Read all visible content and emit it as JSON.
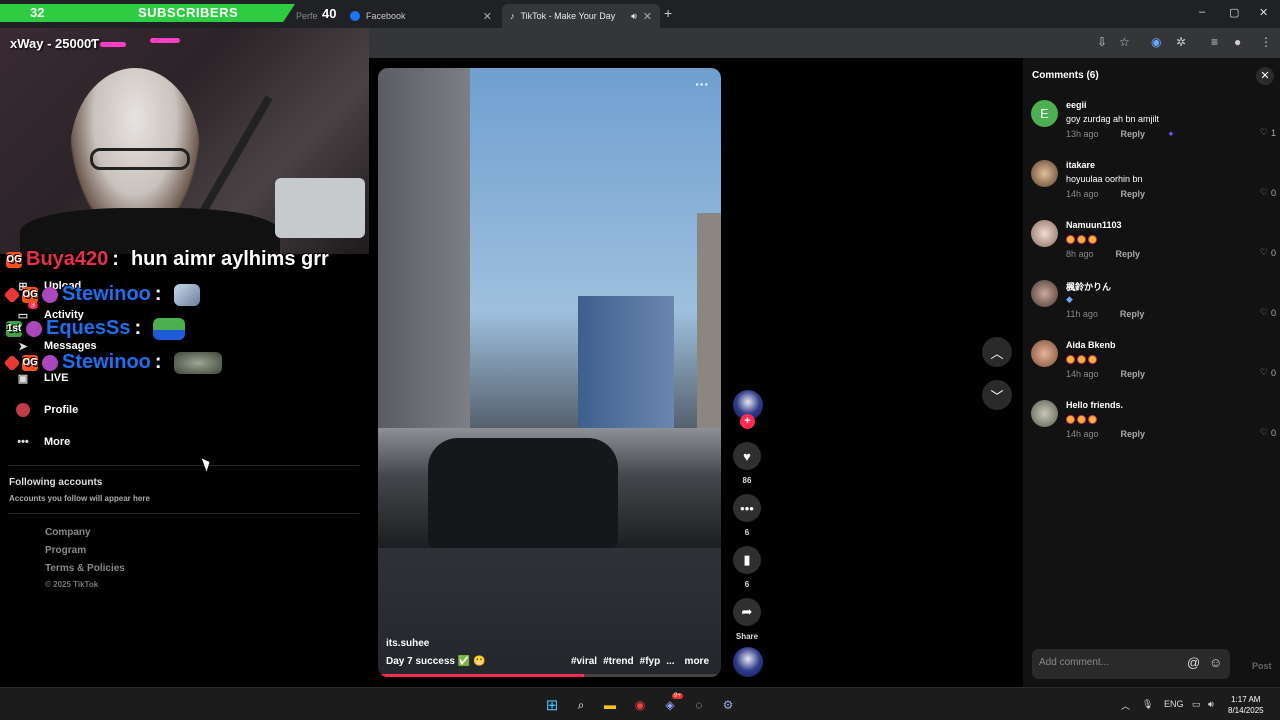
{
  "browser": {
    "tabs": [
      {
        "label": "Facebook",
        "fav_color": "#1877f2"
      },
      {
        "label": "TikTok - Make Your Day",
        "fav_color": "#000000"
      }
    ],
    "hidden_tab_fragment": "Perfe",
    "new_tab": "+",
    "window_controls": [
      "–",
      "▢",
      "✕"
    ]
  },
  "stream": {
    "sub_count": "32",
    "sub_label": "SUBSCRIBERS",
    "goal": "40",
    "cam_name": "xWay - 25000Ƭ"
  },
  "sidebar": {
    "items": [
      {
        "label": "Upload",
        "icon": "plus-square-icon"
      },
      {
        "label": "Activity",
        "icon": "inbox-icon",
        "badge": "3"
      },
      {
        "label": "Messages",
        "icon": "paper-plane-icon"
      },
      {
        "label": "LIVE",
        "icon": "live-tv-icon"
      },
      {
        "label": "Profile",
        "icon": "profile-avatar"
      },
      {
        "label": "More",
        "icon": "more-dots-icon"
      }
    ],
    "following_title": "Following accounts",
    "following_sub": "Accounts you follow will appear here",
    "footer_links": [
      "Company",
      "Program",
      "Terms & Policies"
    ],
    "copyright": "© 2025 TikTok"
  },
  "chat": [
    {
      "user": "Buya420",
      "color": "#e8304a",
      "message": "hun aimr aylhims grr"
    },
    {
      "user": "Stewinoo",
      "color": "#1e6ff0",
      "message": ""
    },
    {
      "user": "EquesSs",
      "color": "#1e6ff0",
      "message": ""
    },
    {
      "user": "Stewinoo",
      "color": "#1e6ff0",
      "message": ""
    }
  ],
  "video": {
    "username": "its.suhee",
    "description": "Day 7 success ✅ 😬",
    "tags": [
      "#viral",
      "#trend",
      "#fyp",
      "...",
      "more"
    ],
    "progress": 0.6,
    "more_icon": "···"
  },
  "actions": {
    "likes": "86",
    "comments": "6",
    "saves": "6",
    "share_label": "Share"
  },
  "comments": {
    "title": "Comments (6)",
    "placeholder": "Add comment...",
    "post_label": "Post",
    "items": [
      {
        "user": "eegii",
        "text": "goy zurdag ah bn amjilt",
        "time": "13h ago",
        "reply": "Reply",
        "likes": "1",
        "avatar_color": "#4caf50",
        "initial": "E"
      },
      {
        "user": "itakare",
        "text": "hoyuulaa oorhin bn",
        "time": "14h ago",
        "reply": "Reply",
        "likes": "0",
        "avatar_color": "#b98d6a",
        "initial": ""
      },
      {
        "user": "Namuun1103",
        "text": "",
        "time": "8h ago",
        "reply": "Reply",
        "likes": "0",
        "avatar_color": "#d9b9b0",
        "initial": ""
      },
      {
        "user": "楓鈴かりん",
        "text": "",
        "time": "11h ago",
        "reply": "Reply",
        "likes": "0",
        "avatar_color": "#8a6f66",
        "initial": ""
      },
      {
        "user": "Aida Bkenb",
        "text": "",
        "time": "14h ago",
        "reply": "Reply",
        "likes": "0",
        "avatar_color": "#c58f6f",
        "initial": ""
      },
      {
        "user": "Hello friends.",
        "text": "",
        "time": "14h ago",
        "reply": "Reply",
        "likes": "0",
        "avatar_color": "#9a9a86",
        "initial": ""
      }
    ]
  },
  "taskbar": {
    "lang": "ENG",
    "time": "1:17 AM",
    "date": "8/14/2025",
    "discord_badge": "9+"
  }
}
